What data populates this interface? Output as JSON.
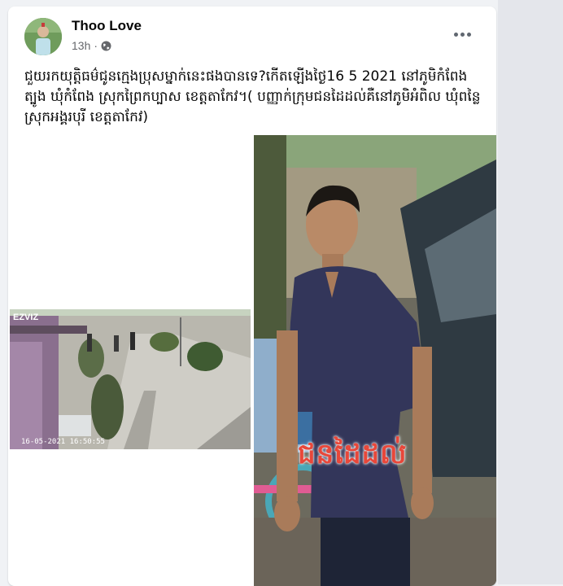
{
  "post": {
    "author": "Thoo Love",
    "timestamp": "13h",
    "privacy_icon": "globe-icon",
    "menu_icon": "more-horizontal-icon",
    "text": "ជួយរកយុត្តិធម៌ជូនក្មេងប្រុសម្នាក់នេះផងបានទេ?កើតឡើងថ្ងៃ16 5 2021 នៅភូមិកំពែងត្បូង ឃុំកំពែង ស្រុកព្រៃកប្បាស ខេត្តតាកែវ។( បញ្ញាក់ក្រុមជនដៃដល់គឺនៅភូមិអំពិល ឃុំពន្លៃ ស្រុកអង្គរបុរី ខេត្តតាកែវ)"
  },
  "media": {
    "cctv": {
      "brand": "EZVIZ",
      "timestamp": "16-05-2021 16:50:55"
    },
    "photo": {
      "caption": "ជនដៃដល់"
    }
  },
  "colors": {
    "caption_red": "#e8473a",
    "card_bg": "#ffffff",
    "page_bg": "#f0f2f5"
  }
}
